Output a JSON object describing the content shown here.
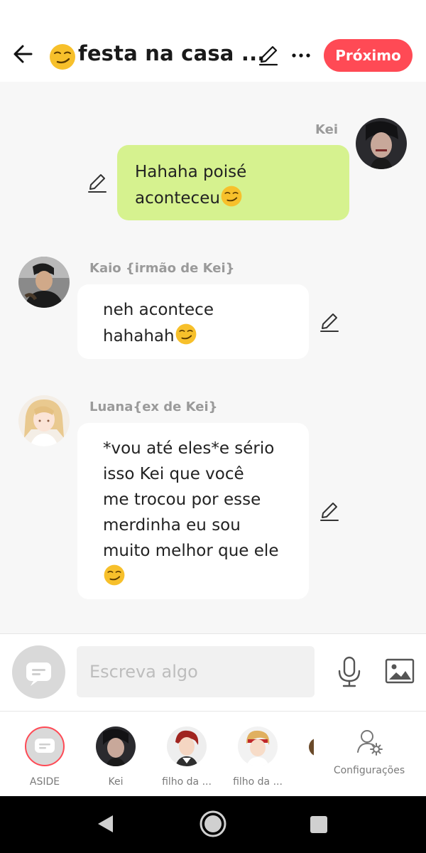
{
  "header": {
    "title_emoji": "smirk-emoji",
    "title": "festa na casa ...",
    "next_label": "Próximo"
  },
  "messages": [
    {
      "sender": "Kei",
      "lines": [
        "Hahaha poisé",
        "aconteceu"
      ],
      "bubble_color": "#d6f28f",
      "side": "right"
    },
    {
      "sender": "Kaio {irmão de Kei}",
      "lines": [
        "neh acontece",
        "hahahah"
      ],
      "bubble_color": "#ffffff",
      "side": "left"
    },
    {
      "sender": "Luana{ex de Kei}",
      "lines": [
        "*vou até eles*e sério",
        "isso Kei que você",
        "me trocou por esse",
        "merdinha eu sou",
        "muito melhor que ele"
      ],
      "bubble_color": "#ffffff",
      "side": "left"
    }
  ],
  "input": {
    "placeholder": "Escreva algo",
    "value": ""
  },
  "characters": [
    {
      "label": "ASIDE"
    },
    {
      "label": "Kei"
    },
    {
      "label": "filho da ..."
    },
    {
      "label": "filho da ..."
    },
    {
      "label": "Configurações"
    }
  ],
  "colors": {
    "accent": "#ff4a55",
    "user_bubble": "#d6f28f",
    "name_gray": "#9a9a9a"
  }
}
